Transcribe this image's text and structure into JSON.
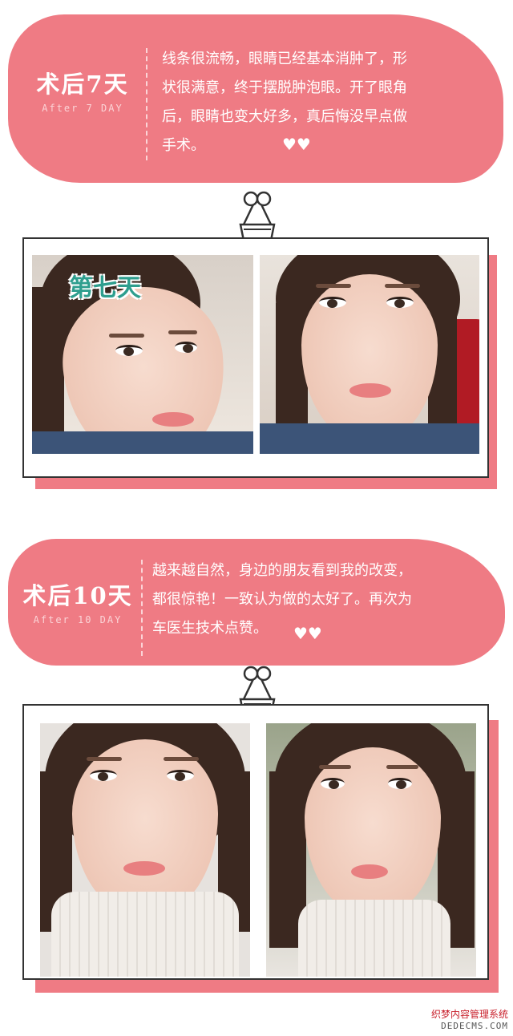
{
  "sections": [
    {
      "title": "术后7天",
      "subtitle": "After 7 DAY",
      "text_lines": [
        "线条很流畅，眼睛已经基本消肿了，形",
        "状很满意，终于摆脱肿泡眼。开了眼角",
        "后，眼睛也变大好多，真后悔没早点做",
        "手术。"
      ],
      "hearts": "♥♥",
      "photo_tag": "第七天"
    },
    {
      "title": "术后10天",
      "subtitle": "After 10 DAY",
      "text_lines": [
        "越来越自然，身边的朋友看到我的改变，",
        "都很惊艳！一致认为做的太好了。再次为",
        "车医生技术点赞。"
      ],
      "hearts": "♥♥"
    }
  ],
  "watermark": {
    "line1": "织梦内容管理系统",
    "line2": "DEDECMS.COM"
  },
  "colors": {
    "accent": "#ef7b84",
    "frame_border": "#333333",
    "tag": "#2e9e8e"
  },
  "icons": [
    "binder-clip-icon",
    "heart-icon"
  ]
}
